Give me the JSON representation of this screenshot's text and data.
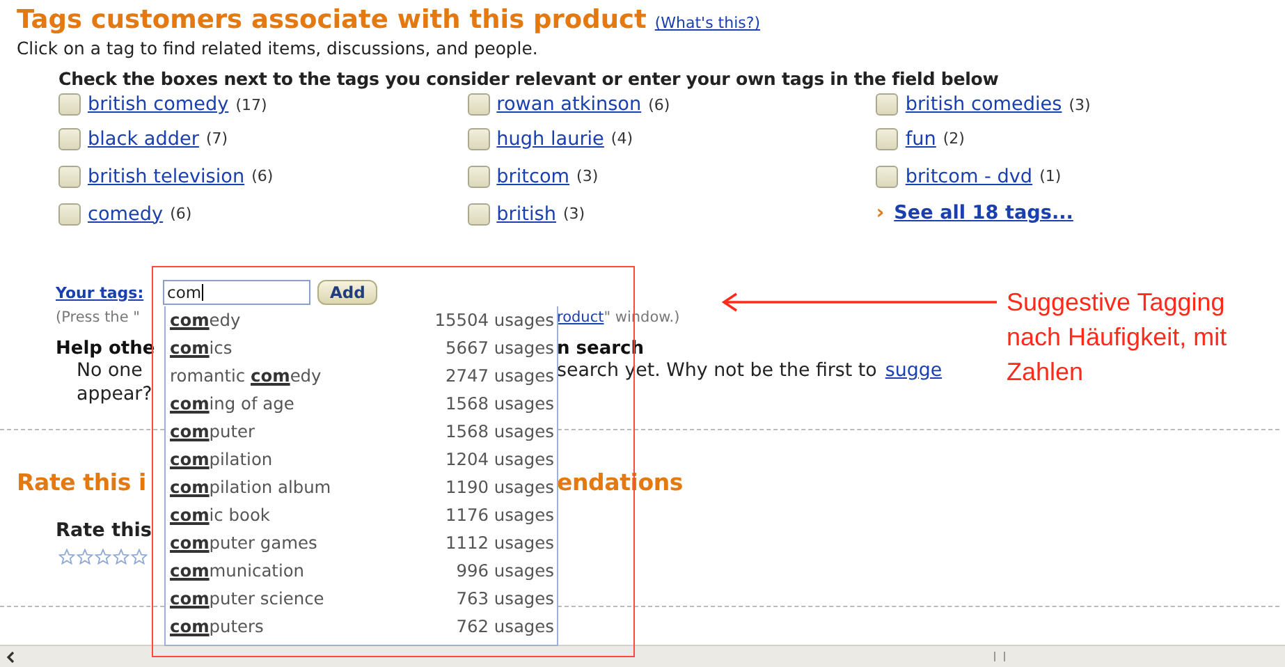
{
  "heading": {
    "title": "Tags customers associate with this product",
    "help_link": "(What's this?)"
  },
  "intro": "Click on a tag to find related items, discussions, and people.",
  "check_heading": "Check the boxes next to the tags you consider relevant or enter your own tags in the field below",
  "tag_columns": [
    [
      {
        "label": "british comedy",
        "count": "(17)",
        "checked": false
      },
      {
        "label": "black adder",
        "count": "(7)",
        "checked": false
      },
      {
        "label": "british television",
        "count": "(6)",
        "checked": false
      },
      {
        "label": "comedy",
        "count": "(6)",
        "checked": false
      }
    ],
    [
      {
        "label": "rowan atkinson",
        "count": "(6)",
        "checked": false
      },
      {
        "label": "hugh laurie",
        "count": "(4)",
        "checked": false
      },
      {
        "label": "britcom",
        "count": "(3)",
        "checked": false
      },
      {
        "label": "british",
        "count": "(3)",
        "checked": false
      }
    ],
    [
      {
        "label": "british comedies",
        "count": "(3)",
        "checked": false
      },
      {
        "label": "fun",
        "count": "(2)",
        "checked": false
      },
      {
        "label": "britcom - dvd",
        "count": "(1)",
        "checked": false
      }
    ]
  ],
  "see_all": {
    "marker": "›",
    "label": "See all 18 tags..."
  },
  "your_tags": {
    "label": "Your tags:",
    "value": "com",
    "button": "Add"
  },
  "press_note": {
    "left": "(Press the \"",
    "link": "roduct",
    "right": "\" window.)"
  },
  "help_section": {
    "title_left": "Help othe",
    "title_right": "n search",
    "text_left": "No one",
    "text_right": "search yet. Why not be the first to",
    "link": "sugge",
    "second_line": "appear?"
  },
  "rate_section": {
    "title_left": "Rate this i",
    "title_right": "endations",
    "subtitle": "Rate this",
    "stars": 0
  },
  "suggestions": [
    {
      "match": "com",
      "rest": "edy",
      "usages": "15504 usages"
    },
    {
      "match": "com",
      "rest": "ics",
      "usages": "5667 usages"
    },
    {
      "before": "romantic ",
      "match": "com",
      "rest": "edy",
      "usages": "2747 usages"
    },
    {
      "match": "com",
      "rest": "ing of age",
      "usages": "1568 usages"
    },
    {
      "match": "com",
      "rest": "puter",
      "usages": "1568 usages"
    },
    {
      "match": "com",
      "rest": "pilation",
      "usages": "1204 usages"
    },
    {
      "match": "com",
      "rest": "pilation album",
      "usages": "1190 usages"
    },
    {
      "match": "com",
      "rest": "ic book",
      "usages": "1176 usages"
    },
    {
      "match": "com",
      "rest": "puter games",
      "usages": "1112 usages"
    },
    {
      "match": "com",
      "rest": "munication",
      "usages": "996 usages"
    },
    {
      "match": "com",
      "rest": "puter science",
      "usages": "763 usages"
    },
    {
      "match": "com",
      "rest": "puters",
      "usages": "762 usages"
    }
  ],
  "annotation": "Suggestive Tagging nach Häufigkeit, mit Zahlen"
}
